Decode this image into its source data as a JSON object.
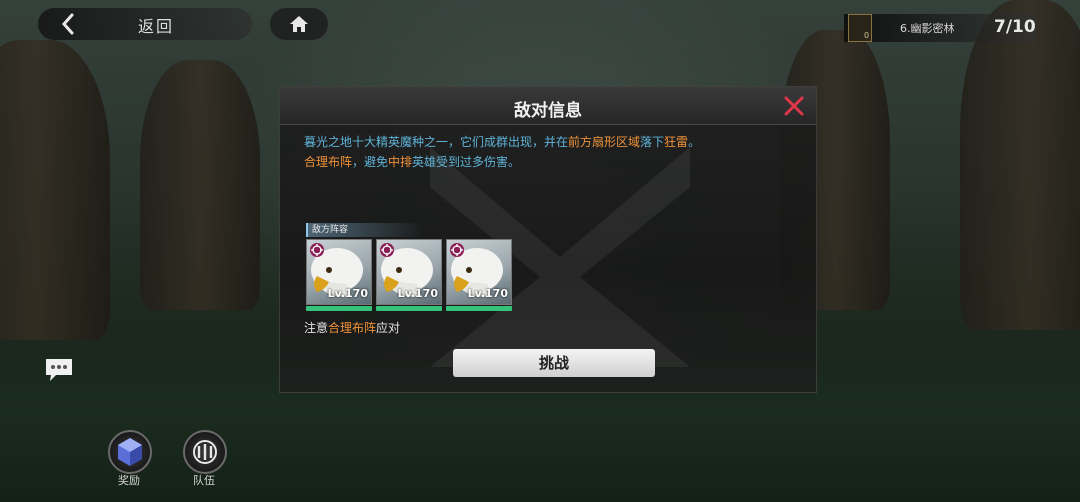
{
  "nav": {
    "back_label": "返回"
  },
  "level": {
    "emblem_num": "0",
    "name": "6.幽影密林",
    "progress": "7/10"
  },
  "dialog": {
    "title": "敌对信息",
    "desc": {
      "p1_a": "暮光之地十大精英魔种之一，它们成群出现，并在",
      "p1_b": "前方扇形区域",
      "p1_c": "落下",
      "p1_d": "狂雷",
      "p1_e": "。",
      "p2_a": "合理布阵",
      "p2_b": "，避免",
      "p2_c": "中排",
      "p2_d": "英雄受到过多伤害。"
    },
    "enemy_tag": "敌方阵容",
    "enemies": [
      {
        "level": "Lv.170"
      },
      {
        "level": "Lv.170"
      },
      {
        "level": "Lv.170"
      }
    ],
    "note_a": "注意",
    "note_b": "合理布阵",
    "note_c": "应对",
    "challenge_label": "挑战"
  },
  "bottom": {
    "rewards_label": "奖励",
    "team_label": "队伍"
  },
  "colors": {
    "highlight": "#f0913a",
    "desc_blue": "#5fb3d8",
    "close_red": "#e0364a",
    "hp_green": "#35c27a"
  }
}
